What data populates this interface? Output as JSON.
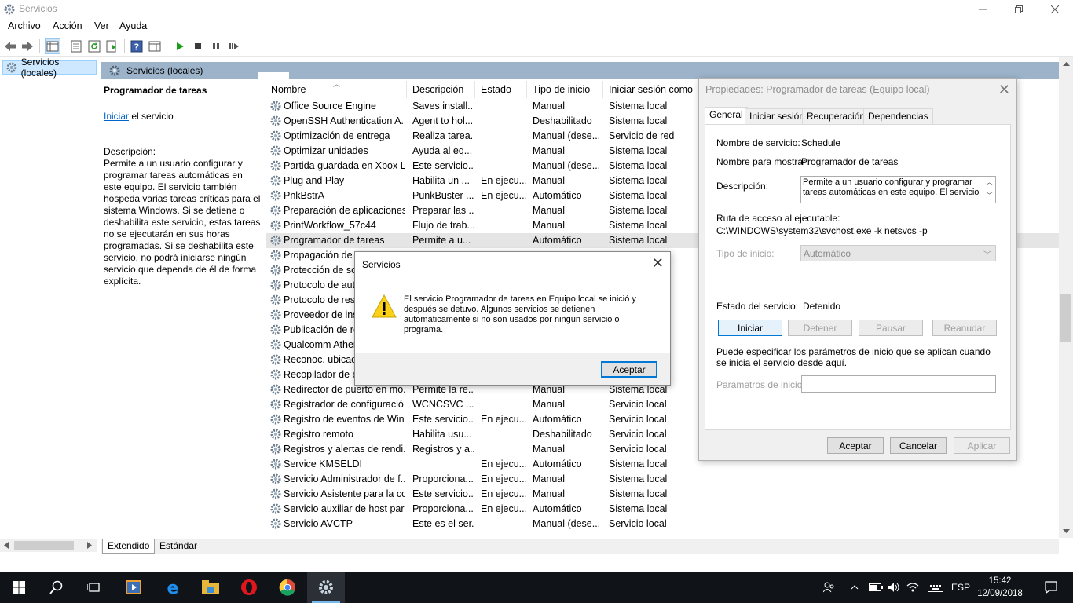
{
  "window": {
    "title": "Servicios"
  },
  "menu": [
    "Archivo",
    "Acción",
    "Ver",
    "Ayuda"
  ],
  "tree": {
    "node_label": "Servicios (locales)"
  },
  "content": {
    "header_label": "Servicios (locales)",
    "description_panel": {
      "title": "Programador de tareas",
      "start_link": "Iniciar",
      "start_suffix": " el servicio",
      "desc_label": "Descripción:",
      "desc_text": "Permite a un usuario configurar y programar tareas automáticas en este equipo. El servicio también hospeda varias tareas críticas para el sistema Windows. Si se detiene o deshabilita este servicio, estas tareas no se ejecutarán en sus horas programadas. Si se deshabilita este servicio, no podrá iniciarse ningún servicio que dependa de él de forma explícita."
    },
    "columns": [
      "Nombre",
      "Descripción",
      "Estado",
      "Tipo de inicio",
      "Iniciar sesión como"
    ],
    "rows": [
      {
        "name": "Office  Source Engine",
        "desc": "Saves install...",
        "status": "",
        "start": "Manual",
        "logon": "Sistema local"
      },
      {
        "name": "OpenSSH Authentication A...",
        "desc": "Agent to hol...",
        "status": "",
        "start": "Deshabilitado",
        "logon": "Sistema local"
      },
      {
        "name": "Optimización de entrega",
        "desc": "Realiza tarea...",
        "status": "",
        "start": "Manual (dese...",
        "logon": "Servicio de red"
      },
      {
        "name": "Optimizar unidades",
        "desc": "Ayuda al eq...",
        "status": "",
        "start": "Manual",
        "logon": "Sistema local"
      },
      {
        "name": "Partida guardada en Xbox Li",
        "desc": "Este servicio...",
        "status": "",
        "start": "Manual (dese...",
        "logon": "Sistema local"
      },
      {
        "name": "Plug and Play",
        "desc": "Habilita un ...",
        "status": "En ejecu...",
        "start": "Manual",
        "logon": "Sistema local"
      },
      {
        "name": "PnkBstrA",
        "desc": "PunkBuster ...",
        "status": "En ejecu...",
        "start": "Automático",
        "logon": "Sistema local"
      },
      {
        "name": "Preparación de aplicaciones",
        "desc": "Preparar las ...",
        "status": "",
        "start": "Manual",
        "logon": "Sistema local"
      },
      {
        "name": "PrintWorkflow_57c44",
        "desc": "Flujo de trab...",
        "status": "",
        "start": "Manual",
        "logon": "Sistema local"
      },
      {
        "name": "Programador de tareas",
        "desc": "Permite a u...",
        "status": "",
        "start": "Automático",
        "logon": "Sistema local"
      },
      {
        "name": "Propagación de c",
        "desc": "",
        "status": "",
        "start": "",
        "logon": ""
      },
      {
        "name": "Protección de sof",
        "desc": "",
        "status": "",
        "start": "",
        "logon": ""
      },
      {
        "name": "Protocolo de aut",
        "desc": "",
        "status": "",
        "start": "",
        "logon": ""
      },
      {
        "name": "Protocolo de reso",
        "desc": "",
        "status": "",
        "start": "",
        "logon": ""
      },
      {
        "name": "Proveedor de inst",
        "desc": "",
        "status": "",
        "start": "",
        "logon": ""
      },
      {
        "name": "Publicación de re",
        "desc": "",
        "status": "",
        "start": "",
        "logon": ""
      },
      {
        "name": "Qualcomm Ather",
        "desc": "",
        "status": "",
        "start": "",
        "logon": ""
      },
      {
        "name": "Reconoc. ubicaci",
        "desc": "",
        "status": "",
        "start": "",
        "logon": ""
      },
      {
        "name": "Recopilador de e",
        "desc": "",
        "status": "",
        "start": "",
        "logon": ""
      },
      {
        "name": "Redirector de puerto en mo...",
        "desc": "Permite la re...",
        "status": "",
        "start": "Manual",
        "logon": "Sistema local"
      },
      {
        "name": "Registrador de configuració...",
        "desc": "WCNCSVC ...",
        "status": "",
        "start": "Manual",
        "logon": "Servicio local"
      },
      {
        "name": "Registro de eventos de Win...",
        "desc": "Este servicio...",
        "status": "En ejecu...",
        "start": "Automático",
        "logon": "Servicio local"
      },
      {
        "name": "Registro remoto",
        "desc": "Habilita usu...",
        "status": "",
        "start": "Deshabilitado",
        "logon": "Servicio local"
      },
      {
        "name": "Registros y alertas de rendi...",
        "desc": "Registros y a...",
        "status": "",
        "start": "Manual",
        "logon": "Servicio local"
      },
      {
        "name": "Service KMSELDI",
        "desc": "",
        "status": "En ejecu...",
        "start": "Automático",
        "logon": "Sistema local"
      },
      {
        "name": "Servicio Administrador de f...",
        "desc": "Proporciona...",
        "status": "En ejecu...",
        "start": "Manual",
        "logon": "Sistema local"
      },
      {
        "name": "Servicio Asistente para la co...",
        "desc": "Este servicio...",
        "status": "En ejecu...",
        "start": "Manual",
        "logon": "Sistema local"
      },
      {
        "name": "Servicio auxiliar de host par...",
        "desc": "Proporciona...",
        "status": "En ejecu...",
        "start": "Automático",
        "logon": "Sistema local"
      },
      {
        "name": "Servicio AVCTP",
        "desc": "Este es el ser...",
        "status": "",
        "start": "Manual (dese...",
        "logon": "Servicio local"
      }
    ],
    "tabs": [
      "Extendido",
      "Estándar"
    ]
  },
  "properties": {
    "title": "Propiedades: Programador de tareas (Equipo local)",
    "tabs": [
      "General",
      "Iniciar sesión",
      "Recuperación",
      "Dependencias"
    ],
    "service_name_label": "Nombre de servicio:",
    "service_name": "Schedule",
    "display_name_label": "Nombre para mostrar:",
    "display_name": "Programador de tareas",
    "description_label": "Descripción:",
    "description": "Permite a un usuario configurar y programar tareas automáticas en este equipo. El servicio",
    "path_label": "Ruta de acceso al ejecutable:",
    "path": "C:\\WINDOWS\\system32\\svchost.exe -k netsvcs -p",
    "startup_type_label": "Tipo de inicio:",
    "startup_type": "Automático",
    "status_label": "Estado del servicio:",
    "status": "Detenido",
    "buttons": {
      "start": "Iniciar",
      "stop": "Detener",
      "pause": "Pausar",
      "resume": "Reanudar"
    },
    "params_hint": "Puede especificar los parámetros de inicio que se aplican cuando se inicia el servicio desde aquí.",
    "params_label": "Parámetros de inicio:",
    "params_value": "",
    "footer": {
      "ok": "Aceptar",
      "cancel": "Cancelar",
      "apply": "Aplicar"
    }
  },
  "message_box": {
    "title": "Servicios",
    "text": "El servicio Programador de tareas en Equipo local se inició y después se detuvo. Algunos servicios se detienen automáticamente si no son usados por ningún servicio o programa.",
    "ok": "Aceptar",
    "icon": "warning-icon"
  },
  "taskbar": {
    "language": "ESP",
    "time": "15:42",
    "date": "12/09/2018"
  }
}
